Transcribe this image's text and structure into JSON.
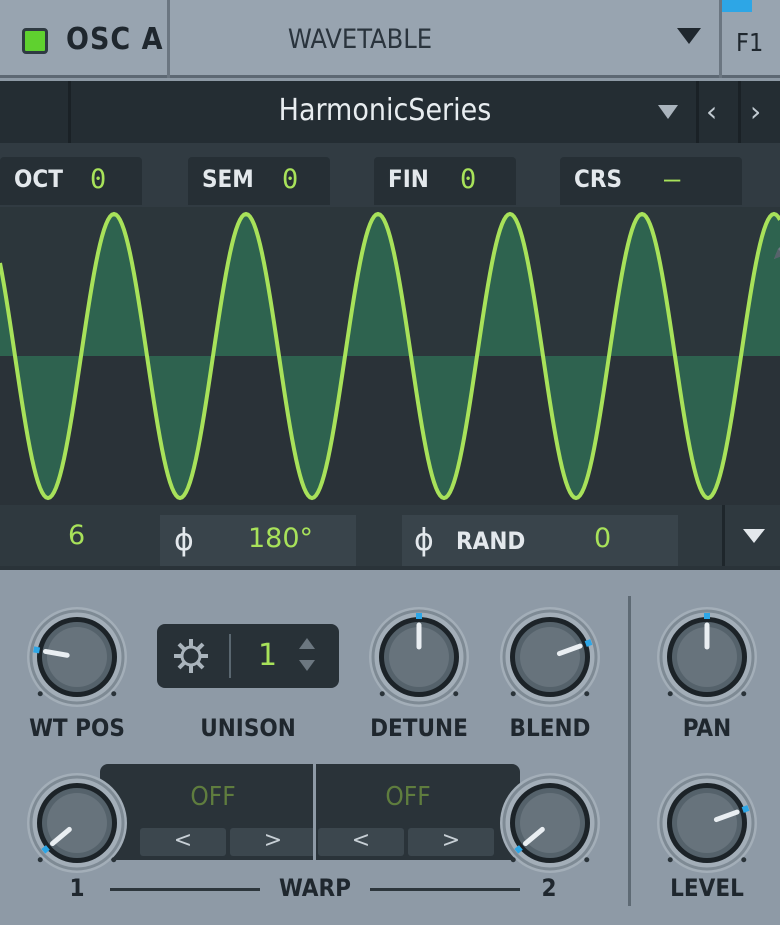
{
  "header": {
    "osc_name": "OSC A",
    "osc_enabled": true,
    "wavetable_type": "WAVETABLE",
    "filter_route": "F1"
  },
  "wavetable": {
    "name": "HarmonicSeries"
  },
  "tuning": {
    "oct_label": "OCT",
    "oct_value": "0",
    "sem_label": "SEM",
    "sem_value": "0",
    "fin_label": "FIN",
    "fin_value": "0",
    "crs_label": "CRS",
    "crs_value": "–"
  },
  "wave_controls": {
    "voices": "6",
    "phase_symbol": "ϕ",
    "phase_value": "180°",
    "rand_symbol": "ϕ",
    "rand_label": "RAND",
    "rand_value": "0"
  },
  "knobs": {
    "wt_pos_label": "WT POS",
    "unison_label": "UNISON",
    "unison_value": "1",
    "detune_label": "DETUNE",
    "blend_label": "BLEND",
    "pan_label": "PAN",
    "level_label": "LEVEL",
    "warp_label": "WARP",
    "warp1_label": "1",
    "warp2_label": "2"
  },
  "warp": {
    "left_mode": "OFF",
    "right_mode": "OFF",
    "prev_symbol": "<",
    "next_symbol": ">"
  },
  "colors": {
    "accent_green": "#a8e25a",
    "led_green": "#5fd12f",
    "accent_blue": "#2da6e6",
    "panel_dark": "#242d33"
  }
}
